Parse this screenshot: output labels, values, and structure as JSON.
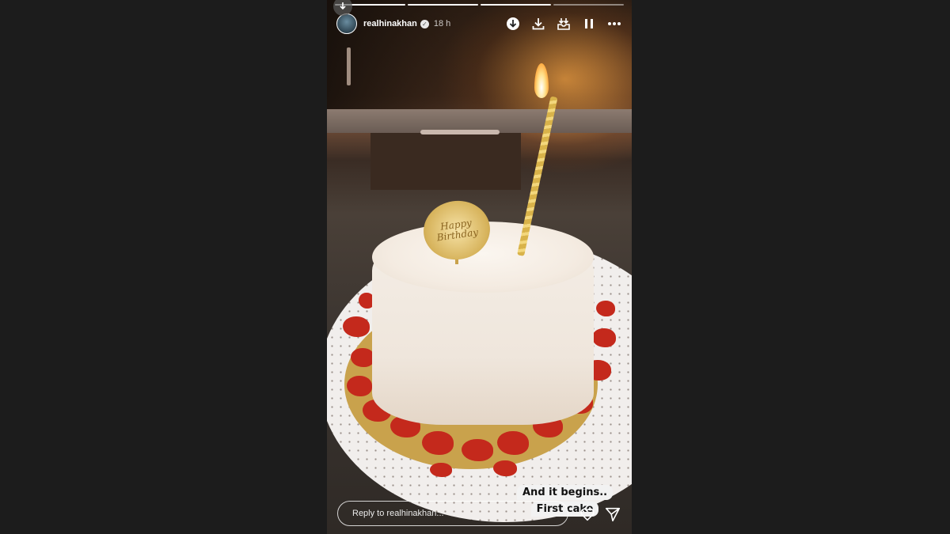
{
  "story": {
    "progress_segments": [
      {
        "state": "complete"
      },
      {
        "state": "complete"
      },
      {
        "state": "active"
      },
      {
        "state": "pending"
      }
    ],
    "header": {
      "username": "realhinakhan",
      "verified": true,
      "timestamp": "18 h",
      "actions": [
        {
          "name": "download-circle-icon"
        },
        {
          "name": "download-icon"
        },
        {
          "name": "save-story-icon"
        },
        {
          "name": "pause-icon"
        },
        {
          "name": "more-options-icon"
        }
      ]
    },
    "image": {
      "topper_text": "Happy Birthday"
    },
    "caption": {
      "line1": "And it begins..",
      "line2": "First cake"
    },
    "footer": {
      "reply_placeholder": "Reply to realhinakhan...",
      "like_icon": "heart-icon",
      "share_icon": "send-icon"
    }
  },
  "colors": {
    "page_background": "#1c1c1c",
    "text_primary": "#ffffff",
    "caption_bg": "#f2f2f2"
  }
}
